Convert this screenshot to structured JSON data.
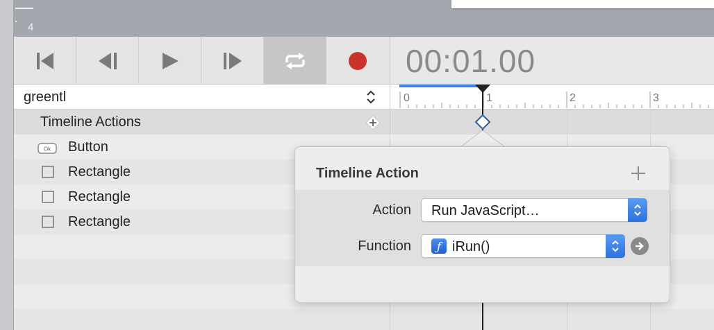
{
  "canvas": {
    "guide_number": "4"
  },
  "transport": {
    "buttons": [
      {
        "name": "go-to-start",
        "icon": "skip-to-start-icon"
      },
      {
        "name": "step-back",
        "icon": "step-back-icon"
      },
      {
        "name": "play",
        "icon": "play-icon"
      },
      {
        "name": "step-forward",
        "icon": "step-forward-icon"
      },
      {
        "name": "loop",
        "icon": "loop-icon",
        "active": true
      },
      {
        "name": "record",
        "icon": "record-icon"
      }
    ],
    "timecode": "00:01.00"
  },
  "timeline_selector": {
    "value": "greentl"
  },
  "ruler": {
    "labels": [
      "0",
      "1",
      "2",
      "3"
    ]
  },
  "layers": {
    "header": "Timeline Actions",
    "items": [
      {
        "label": "Button",
        "icon": "button-ok-icon",
        "icon_text": "Ok"
      },
      {
        "label": "Rectangle",
        "icon": "rectangle-icon"
      },
      {
        "label": "Rectangle",
        "icon": "rectangle-icon"
      },
      {
        "label": "Rectangle",
        "icon": "rectangle-icon"
      }
    ]
  },
  "popover": {
    "title": "Timeline Action",
    "action_label": "Action",
    "action_value": "Run JavaScript…",
    "function_label": "Function",
    "function_value": "iRun()",
    "function_badge": "ƒ"
  },
  "colors": {
    "accent_blue": "#2e72e0",
    "record_red": "#c8342c",
    "playhead_bar": "#3b82e6"
  }
}
